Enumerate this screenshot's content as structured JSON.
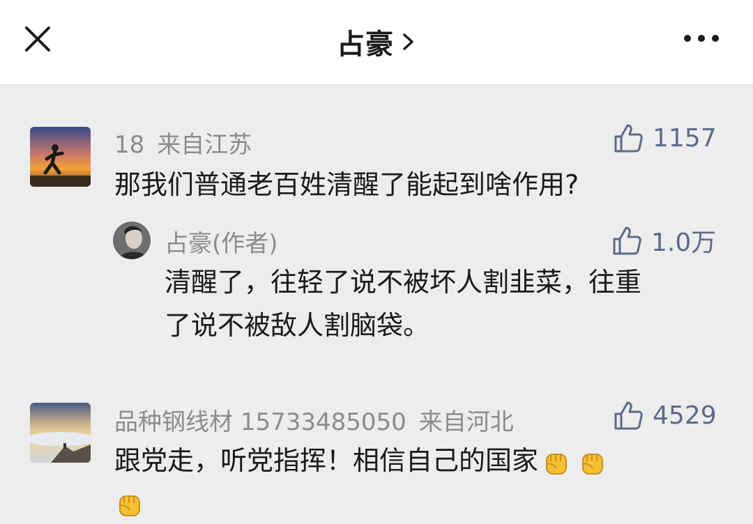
{
  "header": {
    "title": "占豪",
    "close_icon": "close-icon",
    "chevron_icon": "chevron-right-icon",
    "more_icon": "more-icon"
  },
  "comments": [
    {
      "username": "18",
      "location": "来自江苏",
      "likes": "1157",
      "text": "那我们普通老百姓清醒了能起到啥作用?",
      "reply": {
        "username": "占豪(作者)",
        "likes": "1.0万",
        "text_line1": "清醒了，往轻了说不被坏人割韭菜，往重",
        "text_line2": "了说不被敌人割脑袋。"
      }
    },
    {
      "username": "品种钢线材 15733485050",
      "location": "来自河北",
      "likes": "4529",
      "text": "跟党走，听党指挥！相信自己的国家",
      "emojis": [
        "fist-emoji",
        "fist-emoji",
        "fist-emoji"
      ]
    }
  ],
  "colors": {
    "background": "#ededed",
    "header_bg": "#ffffff",
    "meta_gray": "#8c8c8c",
    "like_blue": "#5c6a8a",
    "text": "#1a1a1a"
  }
}
